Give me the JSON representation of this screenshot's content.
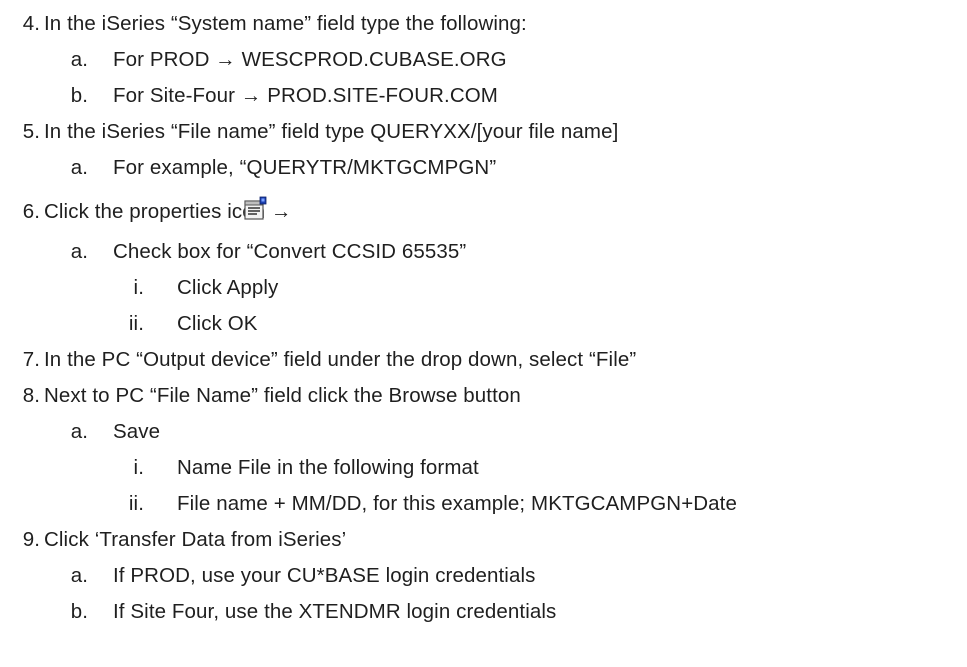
{
  "steps": [
    {
      "num": "4.",
      "text": "In the iSeries “System name” field type the following:"
    },
    {
      "num": "a.",
      "text": "For PROD → WESCPROD.CUBASE.ORG"
    },
    {
      "num": "b.",
      "text": "For Site-Four → PROD.SITE-FOUR.COM"
    },
    {
      "num": "5.",
      "text": "In the iSeries “File name” field type QUERYXX/[your file name]"
    },
    {
      "num": "a.",
      "text": "For example, “QUERYTR/MKTGCMPGN”"
    },
    {
      "num": "6.",
      "text": "Click the properties icon →"
    },
    {
      "num": "a.",
      "text": "Check box for “Convert CCSID 65535”"
    },
    {
      "num": "i.",
      "text": "Click Apply"
    },
    {
      "num": "ii.",
      "text": "Click OK"
    },
    {
      "num": "7.",
      "text": "In the PC “Output device” field under the drop down, select “File”"
    },
    {
      "num": "8.",
      "text": "Next to PC “File Name” field click the Browse button"
    },
    {
      "num": "a.",
      "text": "Save"
    },
    {
      "num": "i.",
      "text": "Name File in the following format"
    },
    {
      "num": "ii.",
      "text": "File name + MM/DD, for this example; MKTGCAMPGN+Date"
    },
    {
      "num": "9.",
      "text": "Click ‘Transfer Data from iSeries’"
    },
    {
      "num": "a.",
      "text": "If PROD, use your CU*BASE login credentials"
    },
    {
      "num": "b.",
      "text": "If Site Four, use the XTENDMR login credentials"
    }
  ],
  "icons": {
    "properties": "properties-icon"
  }
}
